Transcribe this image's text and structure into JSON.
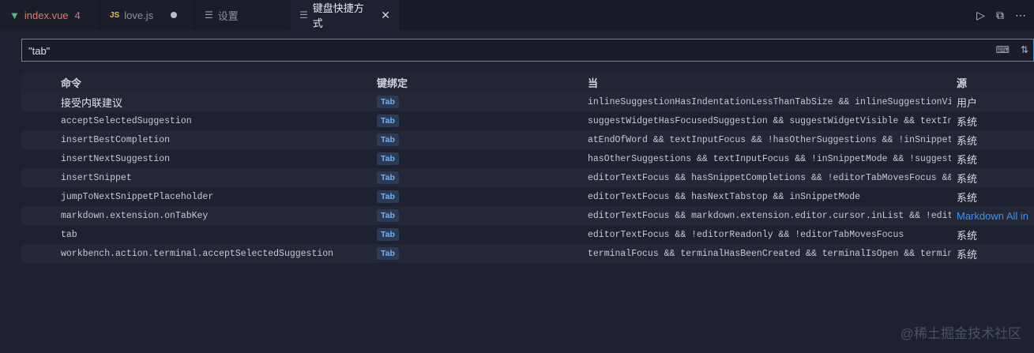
{
  "tabs": [
    {
      "icon": "vue-icon",
      "label": "index.vue",
      "badge": "4"
    },
    {
      "icon": "js-icon",
      "label": "love.js",
      "modified": true
    },
    {
      "icon": "settings-file-icon",
      "label": "设置"
    },
    {
      "icon": "settings-file-icon",
      "label": "键盘快捷方式",
      "active": true
    }
  ],
  "search": {
    "value": "\"tab\""
  },
  "table": {
    "headers": {
      "command": "命令",
      "keybinding": "键绑定",
      "when": "当",
      "source": "源"
    },
    "rows": [
      {
        "command": "接受内联建议",
        "key": "Tab",
        "when": "inlineSuggestionHasIndentationLessThanTabSize && inlineSuggestionVisib…",
        "source": "用户"
      },
      {
        "command": "acceptSelectedSuggestion",
        "key": "Tab",
        "when": "suggestWidgetHasFocusedSuggestion && suggestWidgetVisible && textInput…",
        "source": "系统"
      },
      {
        "command": "insertBestCompletion",
        "key": "Tab",
        "when": "atEndOfWord && textInputFocus && !hasOtherSuggestions && !inSnippetMod…",
        "source": "系统"
      },
      {
        "command": "insertNextSuggestion",
        "key": "Tab",
        "when": "hasOtherSuggestions && textInputFocus && !inSnippetMode && !suggestWid…",
        "source": "系统"
      },
      {
        "command": "insertSnippet",
        "key": "Tab",
        "when": "editorTextFocus && hasSnippetCompletions && !editorTabMovesFocus && !i…",
        "source": "系统"
      },
      {
        "command": "jumpToNextSnippetPlaceholder",
        "key": "Tab",
        "when": "editorTextFocus && hasNextTabstop && inSnippetMode",
        "source": "系统"
      },
      {
        "command": "markdown.extension.onTabKey",
        "key": "Tab",
        "when": "editorTextFocus && markdown.extension.editor.cursor.inList && !editorH…",
        "source": "Markdown All in"
      },
      {
        "command": "tab",
        "key": "Tab",
        "when": "editorTextFocus && !editorReadonly && !editorTabMovesFocus",
        "source": "系统"
      },
      {
        "command": "workbench.action.terminal.acceptSelectedSuggestion",
        "key": "Tab",
        "when": "terminalFocus && terminalHasBeenCreated && terminalIsOpen && terminalS…",
        "source": "系统"
      }
    ]
  },
  "watermark": "@稀土掘金技术社区",
  "colors": {
    "accent": "#3f8fd6",
    "link": "#3794ff",
    "keycap": "#6fb3ff"
  }
}
